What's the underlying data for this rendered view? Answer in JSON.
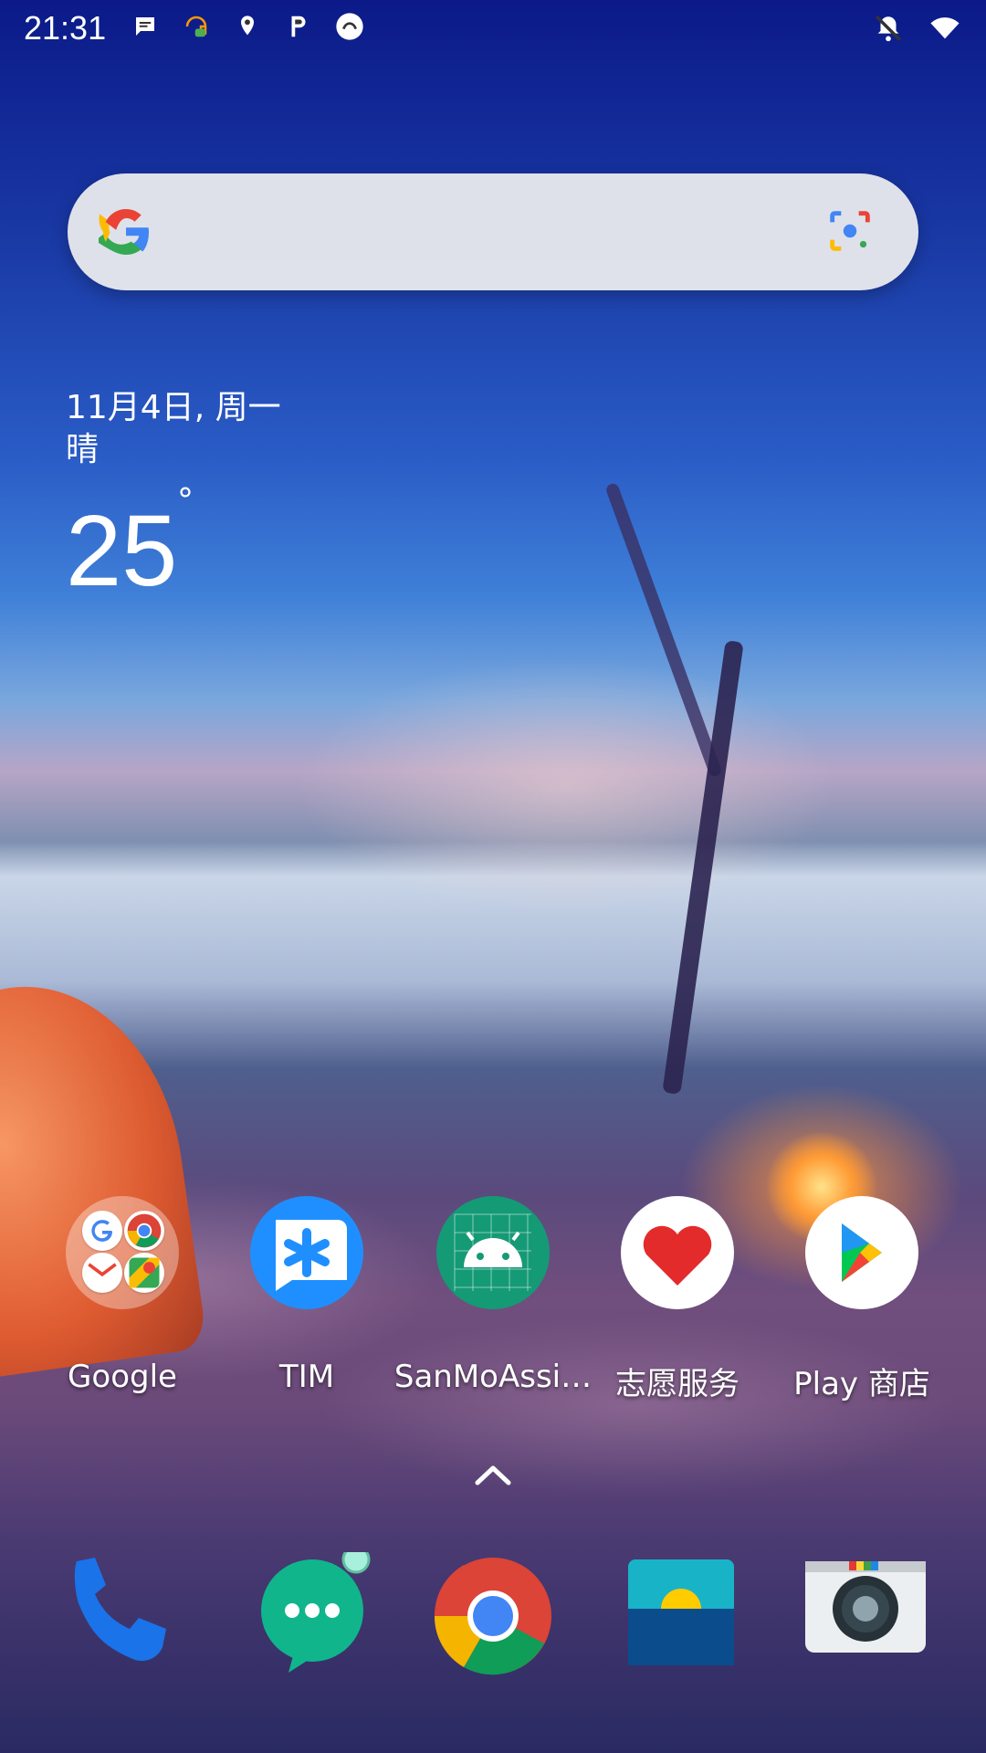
{
  "status_bar": {
    "time": "21:31",
    "icons_left": [
      "chat-bubble-icon",
      "assistant-headset-icon",
      "location-pin-icon",
      "parking-p-icon",
      "ca-badge-icon"
    ],
    "icons_right": [
      "bell-muted-icon",
      "wifi-icon"
    ]
  },
  "search": {
    "provider": "Google",
    "lens_icon": "google-lens-icon"
  },
  "weather": {
    "date": "11月4日, 周一",
    "condition": "晴",
    "temperature": "25",
    "degree_symbol": "°"
  },
  "apps": [
    {
      "label": "Google",
      "type": "folder"
    },
    {
      "label": "TIM"
    },
    {
      "label": "SanMoAssi…"
    },
    {
      "label": "志愿服务"
    },
    {
      "label": "Play 商店"
    }
  ],
  "dock": [
    {
      "name": "phone"
    },
    {
      "name": "messages"
    },
    {
      "name": "chrome"
    },
    {
      "name": "gallery"
    },
    {
      "name": "camera"
    }
  ],
  "colors": {
    "tim_blue": "#1f8fff",
    "sanmo_green": "#159a76",
    "heart_red": "#e32b2b",
    "play_green": "#00c853",
    "play_blue": "#2196f3",
    "play_yellow": "#ffc107",
    "play_red": "#f44336"
  }
}
